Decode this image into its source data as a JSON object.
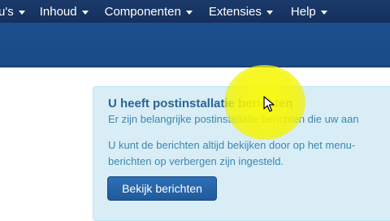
{
  "topnav": {
    "items": [
      {
        "label": "u's"
      },
      {
        "label": "Inhoud"
      },
      {
        "label": "Componenten"
      },
      {
        "label": "Extensies"
      },
      {
        "label": "Help"
      }
    ]
  },
  "message": {
    "title": "U heeft postinstallatie berichten",
    "subtitle": "Er zijn belangrijke postinstallatie berichten die uw aan",
    "body_line1": "U kunt de berichten altijd bekijken door op het menu-",
    "body_line2": "berichten op verbergen zijn ingesteld.",
    "button_label": "Bekijk berichten"
  },
  "colors": {
    "nav_bg": "#1b3a6b",
    "subheader_bg": "#1c4f8e",
    "alert_bg": "#d9edf7",
    "title_text": "#2a6496",
    "body_text": "#3a87ad",
    "button_bg": "#2a67ab",
    "cursor_highlight": "#f5f500"
  },
  "icons": {
    "caret": "caret-down-icon",
    "cursor": "mouse-pointer-icon"
  }
}
